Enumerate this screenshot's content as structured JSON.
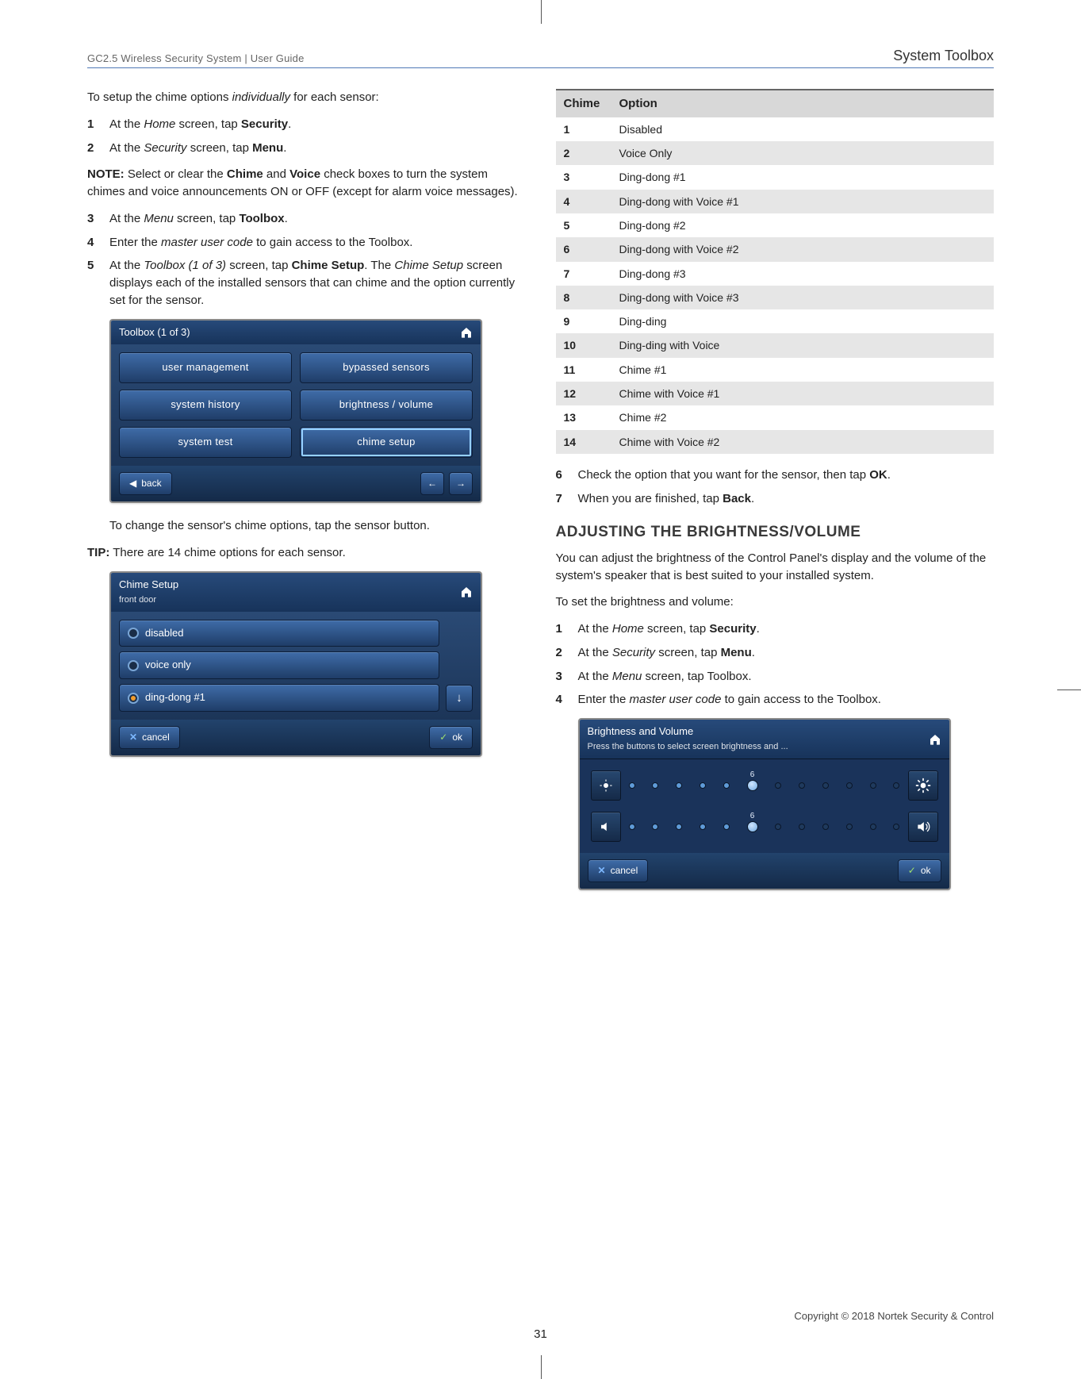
{
  "header": {
    "left": "GC2.5 Wireless Security System | User Guide",
    "right": "System Toolbox"
  },
  "left": {
    "intro_pre": "To setup the chime options ",
    "intro_em": "individually",
    "intro_post": " for each sensor:",
    "steps_a": [
      {
        "n": "1",
        "pre": "At the ",
        "em": "Home",
        "mid": " screen, tap ",
        "bold": "Security",
        "post": "."
      },
      {
        "n": "2",
        "pre": "At the ",
        "em": "Security",
        "mid": " screen, tap ",
        "bold": "Menu",
        "post": "."
      }
    ],
    "note": {
      "label": "NOTE:",
      "body_pre": " Select or clear the ",
      "b1": "Chime",
      "body_mid": " and ",
      "b2": "Voice",
      "body_post": " check boxes to turn the system chimes and voice announcements ON or OFF (except for alarm voice messages)."
    },
    "steps_b": [
      {
        "n": "3",
        "pre": "At the ",
        "em": "Menu",
        "mid": " screen, tap ",
        "bold": "Toolbox",
        "post": "."
      },
      {
        "n": "4",
        "pre": "Enter the ",
        "em": "master user code",
        "mid": " to gain access to the Toolbox.",
        "bold": "",
        "post": ""
      },
      {
        "n": "5",
        "pre": "At the ",
        "em": "Toolbox (1 of 3)",
        "mid": " screen, tap ",
        "bold": "Chime Setup",
        "post": ". The ",
        "em2": "Chime Setup",
        "tail": " screen displays each of the installed sensors that can chime and the option currently set for the sensor."
      }
    ],
    "toolbox_title": "Toolbox (1 of 3)",
    "toolbox_buttons": [
      "user management",
      "bypassed sensors",
      "system history",
      "brightness / volume",
      "system test",
      "chime setup"
    ],
    "toolbox_back": "back",
    "post_toolbox": "To change the sensor's chime options, tap the sensor button.",
    "tip": {
      "label": "TIP:",
      "body": " There are 14 chime options for each sensor."
    },
    "chime_setup_title": "Chime Setup",
    "chime_setup_sub": "front door",
    "chime_options": [
      {
        "label": "disabled",
        "selected": false
      },
      {
        "label": "voice only",
        "selected": false
      },
      {
        "label": "ding-dong #1",
        "selected": true
      }
    ],
    "cancel": "cancel",
    "ok": "ok"
  },
  "right": {
    "table_head": {
      "c1": "Chime",
      "c2": "Option"
    },
    "table": [
      {
        "c": "1",
        "o": "Disabled"
      },
      {
        "c": "2",
        "o": "Voice Only"
      },
      {
        "c": "3",
        "o": "Ding-dong #1"
      },
      {
        "c": "4",
        "o": "Ding-dong with Voice #1"
      },
      {
        "c": "5",
        "o": "Ding-dong #2"
      },
      {
        "c": "6",
        "o": "Ding-dong with Voice #2"
      },
      {
        "c": "7",
        "o": "Ding-dong #3"
      },
      {
        "c": "8",
        "o": "Ding-dong with Voice #3"
      },
      {
        "c": "9",
        "o": "Ding-ding"
      },
      {
        "c": "10",
        "o": "Ding-ding with Voice"
      },
      {
        "c": "11",
        "o": "Chime #1"
      },
      {
        "c": "12",
        "o": "Chime with Voice #1"
      },
      {
        "c": "13",
        "o": "Chime #2"
      },
      {
        "c": "14",
        "o": "Chime with Voice #2"
      }
    ],
    "steps_c": [
      {
        "n": "6",
        "pre": "Check the option that you want for the sensor, then tap ",
        "bold": "OK",
        "post": "."
      },
      {
        "n": "7",
        "pre": "When you are finished, tap ",
        "bold": "Back",
        "post": "."
      }
    ],
    "heading": "ADJUSTING THE BRIGHTNESS/VOLUME",
    "para": "You can adjust the brightness of the Control Panel's display and the volume of the system's speaker that is best suited to your installed system.",
    "lead": "To set the brightness and volume:",
    "steps_d": [
      {
        "n": "1",
        "pre": "At the ",
        "em": "Home",
        "mid": " screen, tap ",
        "bold": "Security",
        "post": "."
      },
      {
        "n": "2",
        "pre": "At the ",
        "em": "Security",
        "mid": " screen, tap ",
        "bold": "Menu",
        "post": "."
      },
      {
        "n": "3",
        "pre": "At the ",
        "em": "Menu",
        "mid": " screen, tap Toolbox.",
        "bold": "",
        "post": ""
      },
      {
        "n": "4",
        "pre": "Enter the ",
        "em": "master user code",
        "mid": " to gain access to the Toolbox.",
        "bold": "",
        "post": ""
      }
    ],
    "bv_title": "Brightness and Volume",
    "bv_sub": "Press the buttons to select screen brightness and ...",
    "slider_value": "6",
    "cancel": "cancel",
    "ok": "ok"
  },
  "footer": {
    "page": "31",
    "copyright": "Copyright ©  2018 Nortek Security & Control"
  }
}
